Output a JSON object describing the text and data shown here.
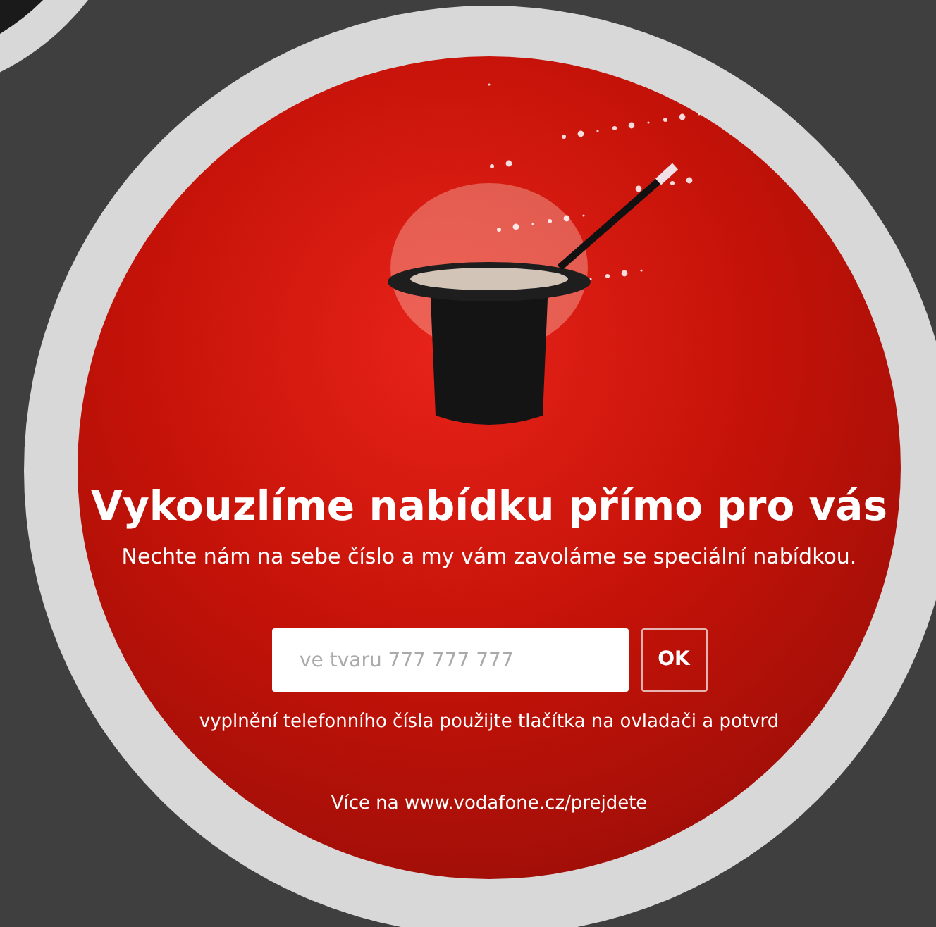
{
  "title": "Vykouzlíme nabídku přímo pro vás",
  "subtitle": "Nechte nám na sebe číslo a my vám zavoláme se speciální nabídkou.",
  "phone_field": {
    "placeholder": "ve tvaru 777 777 777"
  },
  "ok_button": "OK",
  "hint": "vyplnění telefonního čísla použijte tlačítka na ovladači a potvrd",
  "footer": "Více na www.vodafone.cz/prejdete"
}
